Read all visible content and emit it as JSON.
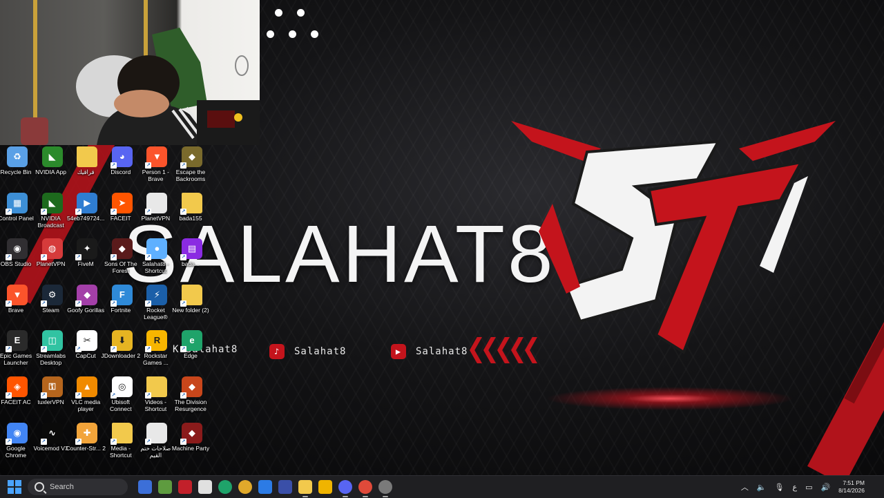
{
  "wallpaper": {
    "brand_title": "SALAHAT8",
    "social_tiktok": "Salahat8",
    "social_youtube": "Salahat8",
    "social_kick": "K.Salahat8",
    "logo_letters": "ST"
  },
  "desktop_icons": [
    {
      "label": "Recycle Bin",
      "icon": "recycle-bin-icon",
      "color": "#5aa0e6"
    },
    {
      "label": "NVIDIA App",
      "icon": "nvidia-icon",
      "color": "#2b8a2b"
    },
    {
      "label": "قراقيك",
      "icon": "folder-icon",
      "color": "#f2c94c"
    },
    {
      "label": "Discord",
      "icon": "discord-icon",
      "color": "#5865f2"
    },
    {
      "label": "Person 1 - Brave",
      "icon": "brave-icon",
      "color": "#fb542b"
    },
    {
      "label": "Escape the Backrooms",
      "icon": "game-icon",
      "color": "#7a6a2c"
    },
    {
      "label": "Control Panel",
      "icon": "control-panel-icon",
      "color": "#3d8fd6"
    },
    {
      "label": "NVIDIA Broadcast",
      "icon": "nvidia-broadcast-icon",
      "color": "#1d6a1d"
    },
    {
      "label": "54eb749724...",
      "icon": "video-file-icon",
      "color": "#2f7dd1"
    },
    {
      "label": "FACEIT",
      "icon": "faceit-icon",
      "color": "#ff5500"
    },
    {
      "label": "PlanetVPN",
      "icon": "file-icon",
      "color": "#e8e8e8"
    },
    {
      "label": "bada155",
      "icon": "folder-icon",
      "color": "#f2c94c"
    },
    {
      "label": "OBS Studio",
      "icon": "obs-icon",
      "color": "#302e31"
    },
    {
      "label": "PlanetVPN",
      "icon": "planetvpn-icon",
      "color": "#d63b3b"
    },
    {
      "label": "FiveM",
      "icon": "fivem-icon",
      "color": "#1a1a1a"
    },
    {
      "label": "Sons Of The Forest",
      "icon": "game-icon",
      "color": "#5a1b1b"
    },
    {
      "label": "Salahat8 - Shortcut",
      "icon": "app-icon",
      "color": "#5fb0ff"
    },
    {
      "label": "bada...",
      "icon": "winrar-icon",
      "color": "#8a2be2"
    },
    {
      "label": "Brave",
      "icon": "brave-icon",
      "color": "#fb542b"
    },
    {
      "label": "Steam",
      "icon": "steam-icon",
      "color": "#1b2838"
    },
    {
      "label": "Goofy Gorillas",
      "icon": "game-icon",
      "color": "#a33fa8"
    },
    {
      "label": "Fortnite",
      "icon": "fortnite-icon",
      "color": "#2f8ad8"
    },
    {
      "label": "Rocket League®",
      "icon": "rocket-league-icon",
      "color": "#1b5fa8"
    },
    {
      "label": "New folder (2)",
      "icon": "folder-icon",
      "color": "#f2c94c"
    },
    {
      "label": "Epic Games Launcher",
      "icon": "epic-games-icon",
      "color": "#2a2a2a"
    },
    {
      "label": "Streamlabs Desktop",
      "icon": "streamlabs-icon",
      "color": "#31c3a2"
    },
    {
      "label": "CapCut",
      "icon": "capcut-icon",
      "color": "#ffffff"
    },
    {
      "label": "JDownloader 2",
      "icon": "jdownloader-icon",
      "color": "#e6b422"
    },
    {
      "label": "Rockstar Games ...",
      "icon": "rockstar-icon",
      "color": "#f7b500"
    },
    {
      "label": "Edge",
      "icon": "edge-icon",
      "color": "#1fa36a"
    },
    {
      "label": "FACEIT AC",
      "icon": "faceit-ac-icon",
      "color": "#ff5500"
    },
    {
      "label": "tuxlerVPN",
      "icon": "tuxlervpn-icon",
      "color": "#b5651d"
    },
    {
      "label": "VLC media player",
      "icon": "vlc-icon",
      "color": "#f08a00"
    },
    {
      "label": "Ubisoft Connect",
      "icon": "ubisoft-icon",
      "color": "#ffffff"
    },
    {
      "label": "Videos - Shortcut",
      "icon": "folder-icon",
      "color": "#f2c94c"
    },
    {
      "label": "The Division Resurgence",
      "icon": "game-icon",
      "color": "#c8461b"
    },
    {
      "label": "Google Chrome",
      "icon": "chrome-icon",
      "color": "#4285f4"
    },
    {
      "label": "Voicemod V3",
      "icon": "voicemod-icon",
      "color": "#0a0a0a"
    },
    {
      "label": "Counter-Str... 2",
      "icon": "cs2-icon",
      "color": "#f2a43a"
    },
    {
      "label": "Media - Shortcut",
      "icon": "folder-icon",
      "color": "#f2c94c"
    },
    {
      "label": "صلاحات ختم القيم",
      "icon": "file-icon",
      "color": "#e8e8e8"
    },
    {
      "label": "Machine Party",
      "icon": "game-icon",
      "color": "#8a1b1b"
    }
  ],
  "taskbar": {
    "search_placeholder": "Search",
    "apps": [
      {
        "name": "start-icon"
      },
      {
        "name": "app-blue-icon",
        "color": "#3c6fd8"
      },
      {
        "name": "app-multi-icon",
        "color": "#5e9b3f"
      },
      {
        "name": "voicemod-taskbar-icon",
        "color": "#c2202a"
      },
      {
        "name": "store-icon",
        "color": "#e0e0e0"
      },
      {
        "name": "edge-taskbar-icon",
        "color": "#1fa36a"
      },
      {
        "name": "chrome-taskbar-icon",
        "color": "#e0a92b"
      },
      {
        "name": "blue-app-icon",
        "color": "#2c7be5"
      },
      {
        "name": "obs-taskbar-icon",
        "color": "#3a4fa8"
      },
      {
        "name": "file-explorer-icon",
        "color": "#f2c94c"
      },
      {
        "name": "yellow-app-icon",
        "color": "#f0b400"
      },
      {
        "name": "discord-taskbar-icon",
        "color": "#5865f2"
      },
      {
        "name": "chrome-2-taskbar-icon",
        "color": "#e04a3a"
      },
      {
        "name": "steam-taskbar-icon",
        "color": "#7a7a7a"
      }
    ],
    "tray_lang": "ع",
    "time": "7:51 PM",
    "date": "8/14/2026"
  }
}
